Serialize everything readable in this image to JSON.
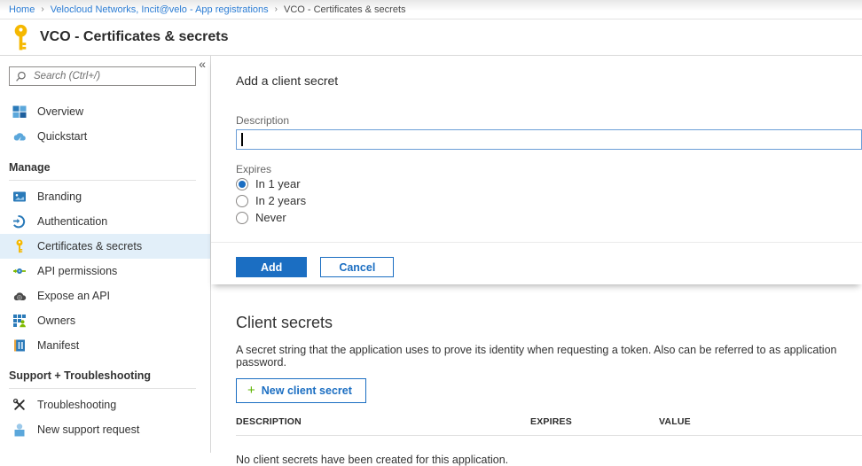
{
  "breadcrumb": {
    "separator": "›",
    "items": [
      {
        "label": "Home"
      },
      {
        "label": "Velocloud Networks, Incit@velo - App registrations"
      },
      {
        "label": "VCO - Certificates & secrets"
      }
    ]
  },
  "header": {
    "title": "VCO - Certificates & secrets",
    "icon": "key-icon"
  },
  "sidebar": {
    "collapse_icon": "«",
    "search": {
      "placeholder": "Search (Ctrl+/)",
      "value": ""
    },
    "groups": [
      {
        "header": "",
        "items": [
          {
            "label": "Overview",
            "icon": "overview-icon"
          },
          {
            "label": "Quickstart",
            "icon": "quickstart-icon"
          }
        ]
      },
      {
        "header": "Manage",
        "items": [
          {
            "label": "Branding",
            "icon": "branding-icon"
          },
          {
            "label": "Authentication",
            "icon": "authentication-icon"
          },
          {
            "label": "Certificates & secrets",
            "icon": "key-icon",
            "selected": true
          },
          {
            "label": "API permissions",
            "icon": "api-permissions-icon"
          },
          {
            "label": "Expose an API",
            "icon": "expose-api-icon"
          },
          {
            "label": "Owners",
            "icon": "owners-icon"
          },
          {
            "label": "Manifest",
            "icon": "manifest-icon"
          }
        ]
      },
      {
        "header": "Support + Troubleshooting",
        "items": [
          {
            "label": "Troubleshooting",
            "icon": "troubleshooting-icon"
          },
          {
            "label": "New support request",
            "icon": "support-person-icon"
          }
        ]
      }
    ]
  },
  "dialog": {
    "title": "Add a client secret",
    "description_label": "Description",
    "description_value": "",
    "expires_label": "Expires",
    "expires_options": [
      {
        "label": "In 1 year",
        "selected": true
      },
      {
        "label": "In 2 years",
        "selected": false
      },
      {
        "label": "Never",
        "selected": false
      }
    ],
    "add_label": "Add",
    "cancel_label": "Cancel"
  },
  "client_secrets": {
    "title": "Client secrets",
    "description": "A secret string that the application uses to prove its identity when requesting a token. Also can be referred to as application password.",
    "new_button_plus": "+",
    "new_button_label": "New client secret",
    "table_headers": [
      "DESCRIPTION",
      "EXPIRES",
      "VALUE"
    ],
    "empty_message": "No client secrets have been created for this application."
  },
  "colors": {
    "accent_blue": "#1b6ec2",
    "link_blue": "#2b7cd3",
    "key_yellow": "#f5b800",
    "plus_green": "#5db300",
    "selected_item_bg": "#e2eff9"
  }
}
